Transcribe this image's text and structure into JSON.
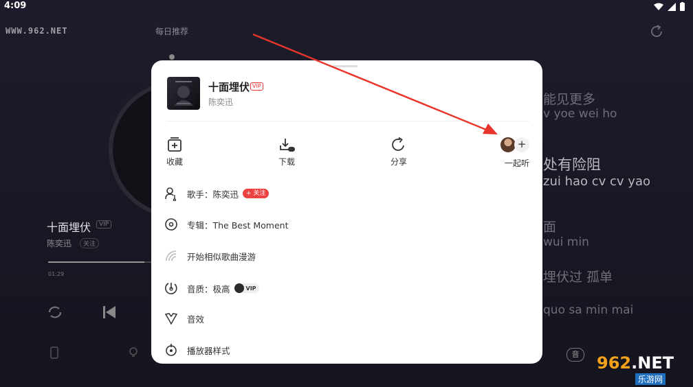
{
  "status": {
    "time": "4:09"
  },
  "background": {
    "watermark_top": "WWW.962.NET",
    "daily_title": "每日推荐",
    "song_title": "十面埋伏",
    "vip_tag": "VIP",
    "artist": "陈奕迅",
    "follow_tag": "关注",
    "elapsed": "01:29",
    "progress": 0.93,
    "lyrics": [
      "能见更多",
      "v yoe wei ho",
      "处有险阻",
      "zui hao cv cv yao",
      "面",
      "wui min",
      "埋伏过 孤单",
      "quo sa min mai"
    ],
    "quality_btn": "音",
    "watermark_bottom_big": "962",
    "watermark_bottom_net": ".NET",
    "watermark_bottom_small": "乐游网"
  },
  "sheet": {
    "song_title": "十面埋伏",
    "vip_tag": "VIP",
    "artist": "陈奕迅",
    "actions": [
      {
        "label": "收藏",
        "icon": "add-to-playlist-icon"
      },
      {
        "label": "下载",
        "icon": "download-vip-icon"
      },
      {
        "label": "分享",
        "icon": "share-icon"
      },
      {
        "label": "一起听",
        "icon": "listen-together-icon"
      }
    ],
    "menu": {
      "singer": "歌手：陈奕迅",
      "follow": "+ 关注",
      "album": "专辑：The Best Moment",
      "roam": "开始相似歌曲漫游",
      "quality": "音质：极高",
      "quality_vip": "VIP",
      "effects": "音效",
      "player_style": "播放器样式"
    }
  },
  "colors": {
    "accent": "#ec4141",
    "arrow": "#e8352b",
    "sheet_bg": "#ffffff",
    "page_bg": "#1b1b29"
  }
}
